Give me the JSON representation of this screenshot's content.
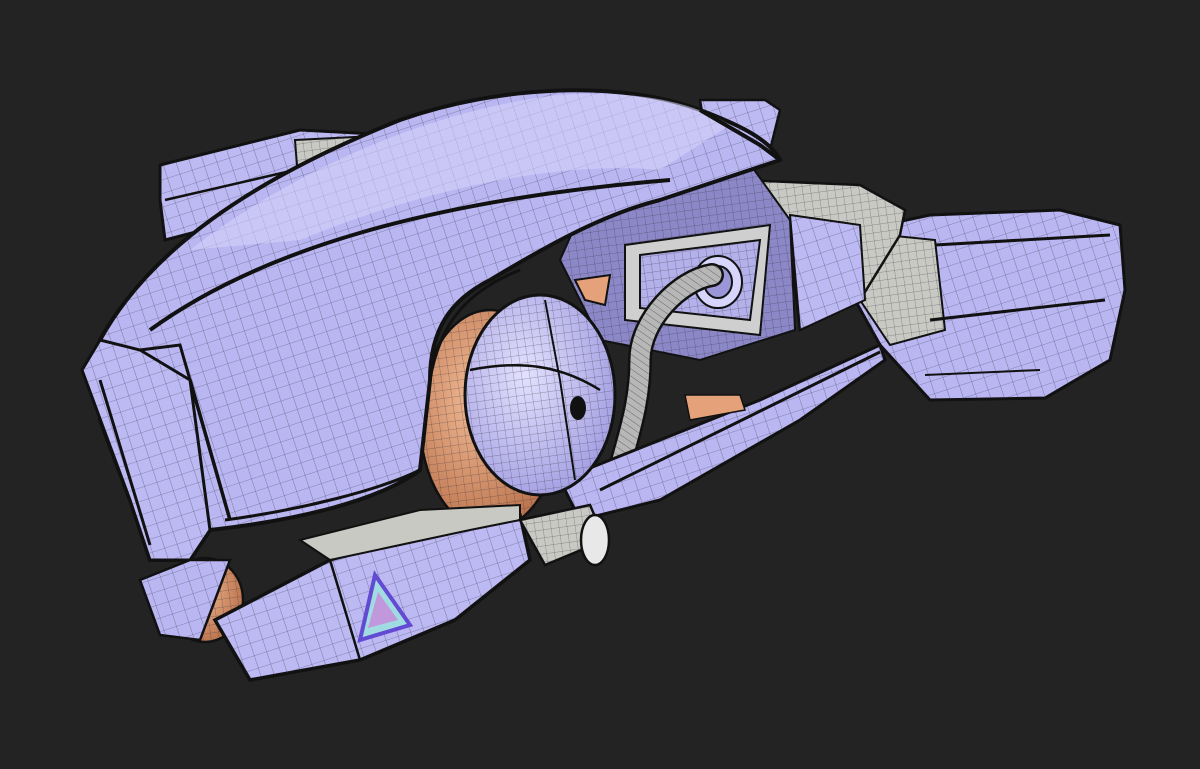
{
  "viewport": {
    "background_color": "#232323"
  },
  "model": {
    "subject": "wireframe-spaceship-model",
    "shading": "wireframe-on-shaded",
    "colors": {
      "hull": "#b9b6f2",
      "hull_light": "#d8d6fb",
      "hull_dark": "#9893d6",
      "metal": "#c9c9c4",
      "metal_dark": "#9a9a96",
      "copper": "#e5a27a",
      "copper_dark": "#b8704a",
      "panel_seam": "#111111",
      "wire": "#2a2a3a"
    },
    "icons": [
      "triangle-decal-icon"
    ]
  }
}
